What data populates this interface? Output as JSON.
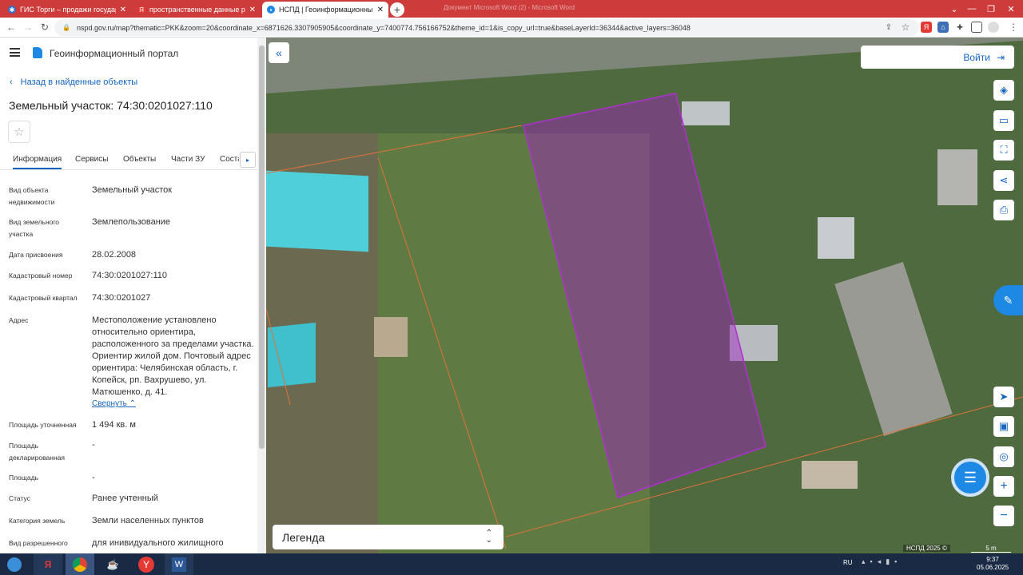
{
  "browser": {
    "tabs": [
      {
        "title": "ГИС Торги – продажи государст",
        "active": false
      },
      {
        "title": "пространственные данные рос",
        "active": false
      },
      {
        "title": "НСПД | Геоинформационный п",
        "active": true
      }
    ],
    "window_title": "Документ Microsoft Word (2) - Microsoft Word",
    "url": "nspd.gov.ru/map?thematic=PKK&zoom=20&coordinate_x=6871626.3307905905&coordinate_y=7400774.756166752&theme_id=1&is_copy_url=true&baseLayerId=36344&active_layers=36048"
  },
  "header": {
    "portal_name": "Геоинформационный портал"
  },
  "panel": {
    "back_label": "Назад в найденные объекты",
    "title": "Земельный участок: 74:30:0201027:110",
    "tabs": [
      "Информация",
      "Сервисы",
      "Объекты",
      "Части ЗУ",
      "Соста"
    ],
    "rows": [
      {
        "label": "Вид объекта недвижимости",
        "value": "Земельный участок"
      },
      {
        "label": "Вид земельного участка",
        "value": "Землепользование"
      },
      {
        "label": "Дата присвоения",
        "value": "28.02.2008"
      },
      {
        "label": "Кадастровый номер",
        "value": "74:30:0201027:110"
      },
      {
        "label": "Кадастровый квартал",
        "value": "74:30:0201027"
      },
      {
        "label": "Адрес",
        "value": "Местоположение установлено относительно ориентира, расположенного за пределами участка. Ориентир жилой дом. Почтовый адрес ориентира: Челябинская область, г. Копейск, рп. Вахрушево, ул. Матюшенко, д. 41."
      },
      {
        "label": "Площадь уточненная",
        "value": "1 494 кв. м"
      },
      {
        "label": "Площадь декларированная",
        "value": "-"
      },
      {
        "label": "Площадь",
        "value": "-"
      },
      {
        "label": "Статус",
        "value": "Ранее учтенный"
      },
      {
        "label": "Категория земель",
        "value": "Земли населенных пунктов"
      },
      {
        "label": "Вид разрешенного",
        "value": "для инивидуального жилищного"
      }
    ],
    "collapse_label": "Свернуть"
  },
  "map": {
    "login_label": "Войти",
    "legend_label": "Легенда",
    "copyright": "НСПД 2025 ©",
    "scale_label": "5 m",
    "parcel_color": "#a020c0"
  },
  "taskbar": {
    "lang": "RU",
    "time": "9:37",
    "date": "05.06.2025"
  }
}
